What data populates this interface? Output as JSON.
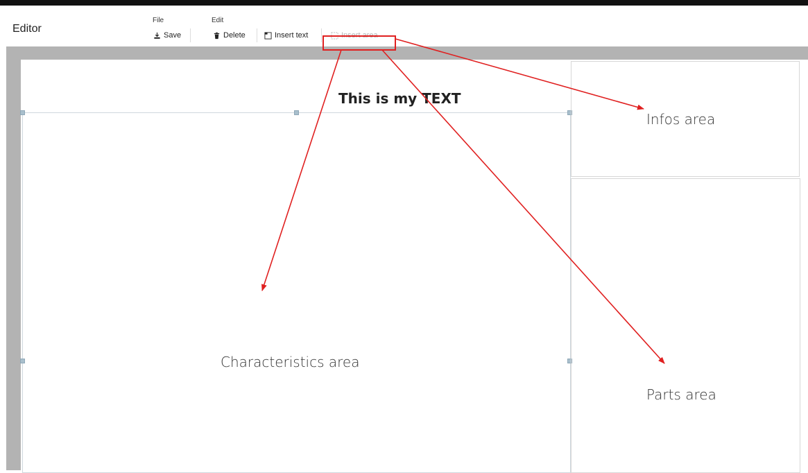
{
  "app": {
    "title": "Editor"
  },
  "menus": {
    "file": {
      "label": "File",
      "save_label": "Save"
    },
    "edit": {
      "label": "Edit",
      "delete_label": "Delete",
      "insert_text_label": "Insert text",
      "insert_area_label": "Insert area"
    }
  },
  "document": {
    "text_block": "This is my TEXT",
    "areas": {
      "characteristics": "Characteristics area",
      "infos": "Infos area",
      "parts": "Parts area"
    }
  },
  "annotation": {
    "color": "#e02020"
  },
  "icons": [
    "save-icon",
    "trash-icon",
    "text-box-icon",
    "area-dashed-icon"
  ]
}
